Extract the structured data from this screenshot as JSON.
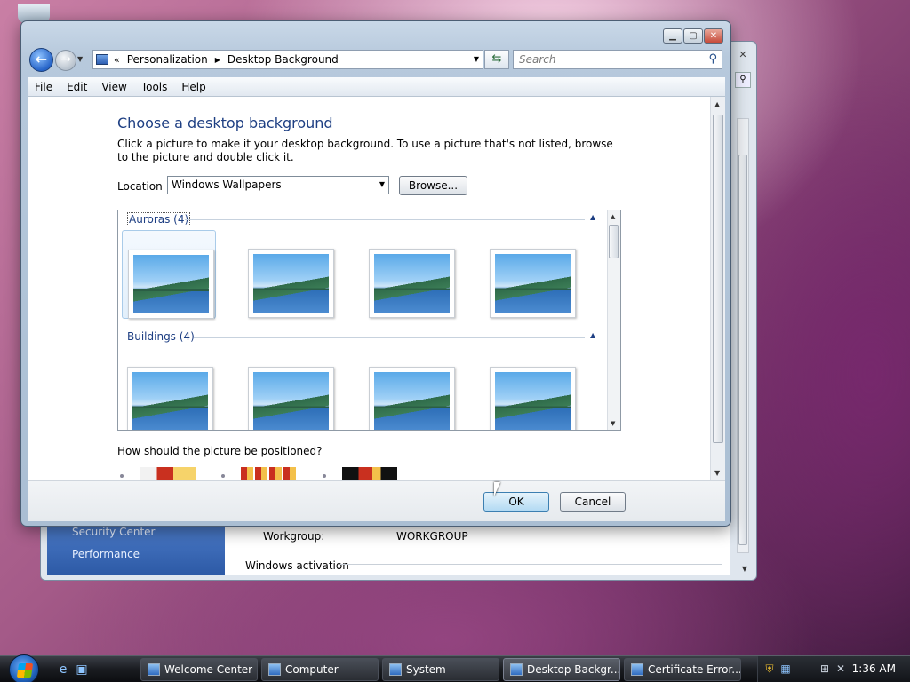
{
  "bg_window": {
    "left_links": [
      "Security Center",
      "Performance"
    ],
    "workgroup_label": "Workgroup:",
    "workgroup_value": "WORKGROUP",
    "activation_heading": "Windows activation"
  },
  "window": {
    "breadcrumb_sep": "«",
    "breadcrumbs": [
      "Personalization",
      "Desktop Background"
    ],
    "search_placeholder": "Search",
    "menu": [
      "File",
      "Edit",
      "View",
      "Tools",
      "Help"
    ],
    "title": "Choose a desktop background",
    "description": "Click a picture to make it your desktop background. To use a picture that's not listed, browse to the picture and double click it.",
    "location_label": "Location",
    "location_value": "Windows Wallpapers",
    "browse_label": "Browse...",
    "groups": [
      {
        "name": "Auroras (4)",
        "count": 4
      },
      {
        "name": "Buildings (4)",
        "count": 4
      }
    ],
    "position_question": "How should the picture be positioned?",
    "ok_label": "OK",
    "cancel_label": "Cancel"
  },
  "taskbar": {
    "tasks": [
      "Welcome Center",
      "Computer",
      "System",
      "Desktop Backgr...",
      "Certificate Error..."
    ],
    "active_task": "Desktop Backgr...",
    "clock": "1:36 AM"
  },
  "icons": {
    "back": "back-arrow-icon",
    "forward": "forward-arrow-icon",
    "refresh": "refresh-icon",
    "search": "search-icon",
    "start": "windows-start-icon"
  }
}
